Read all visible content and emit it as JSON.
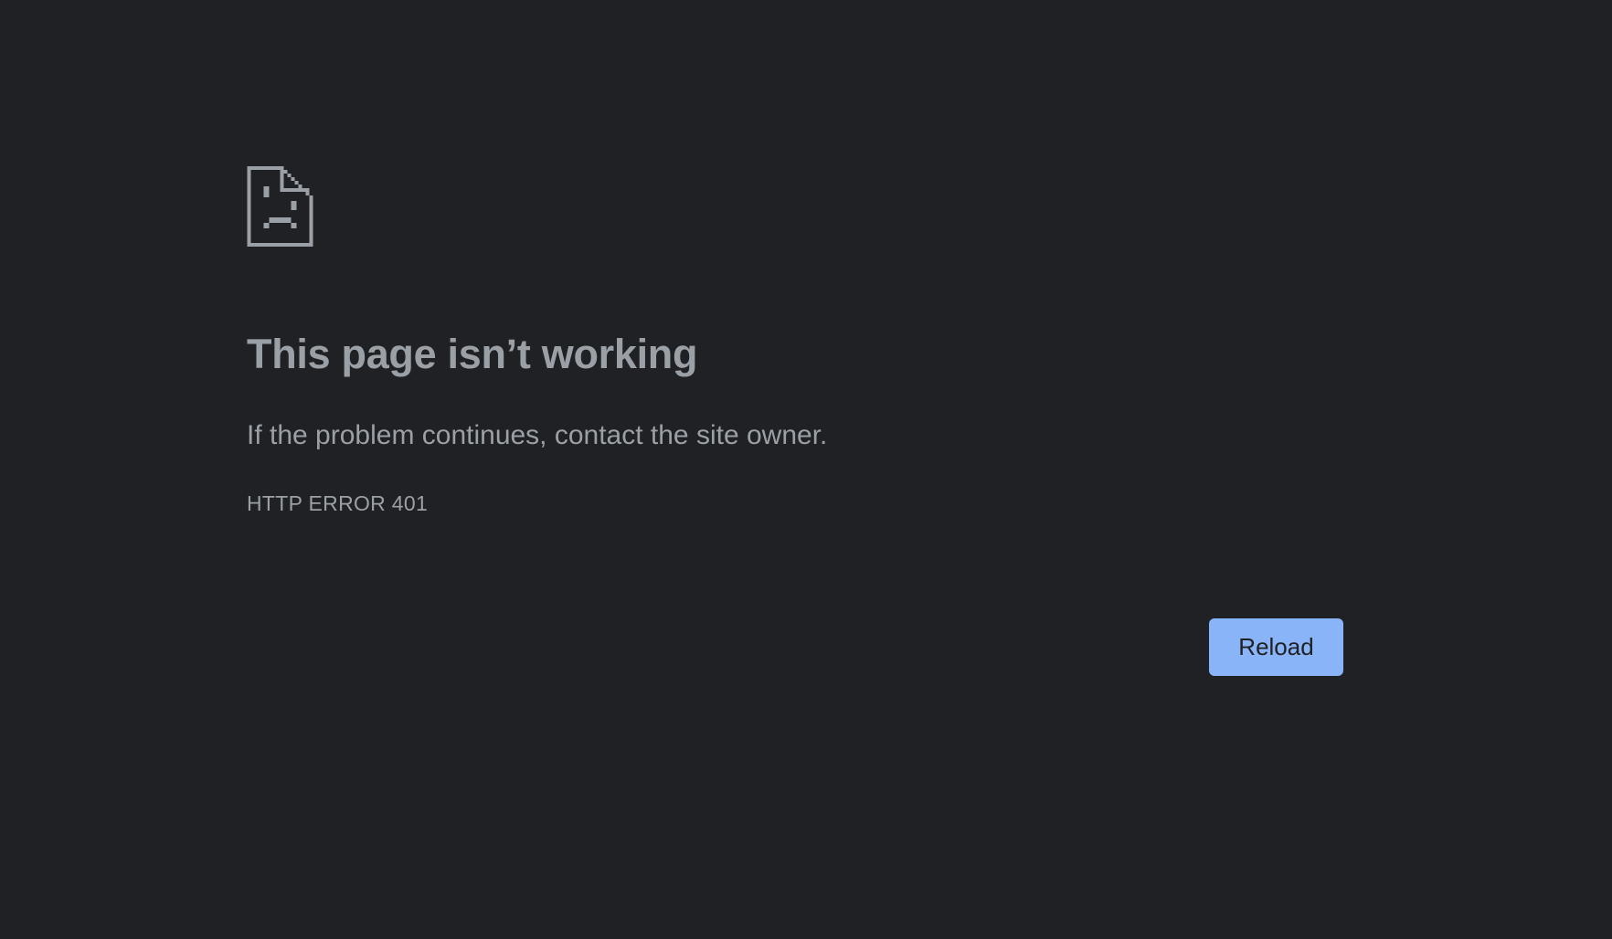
{
  "error": {
    "icon": "sad-document-icon",
    "title": "This page isn’t working",
    "description": "If the problem continues, contact the site owner.",
    "code": "HTTP ERROR 401"
  },
  "actions": {
    "reload_label": "Reload"
  },
  "colors": {
    "background": "#202124",
    "text": "#9aa0a6",
    "button": "#8ab4f8",
    "button_text": "#202124"
  }
}
